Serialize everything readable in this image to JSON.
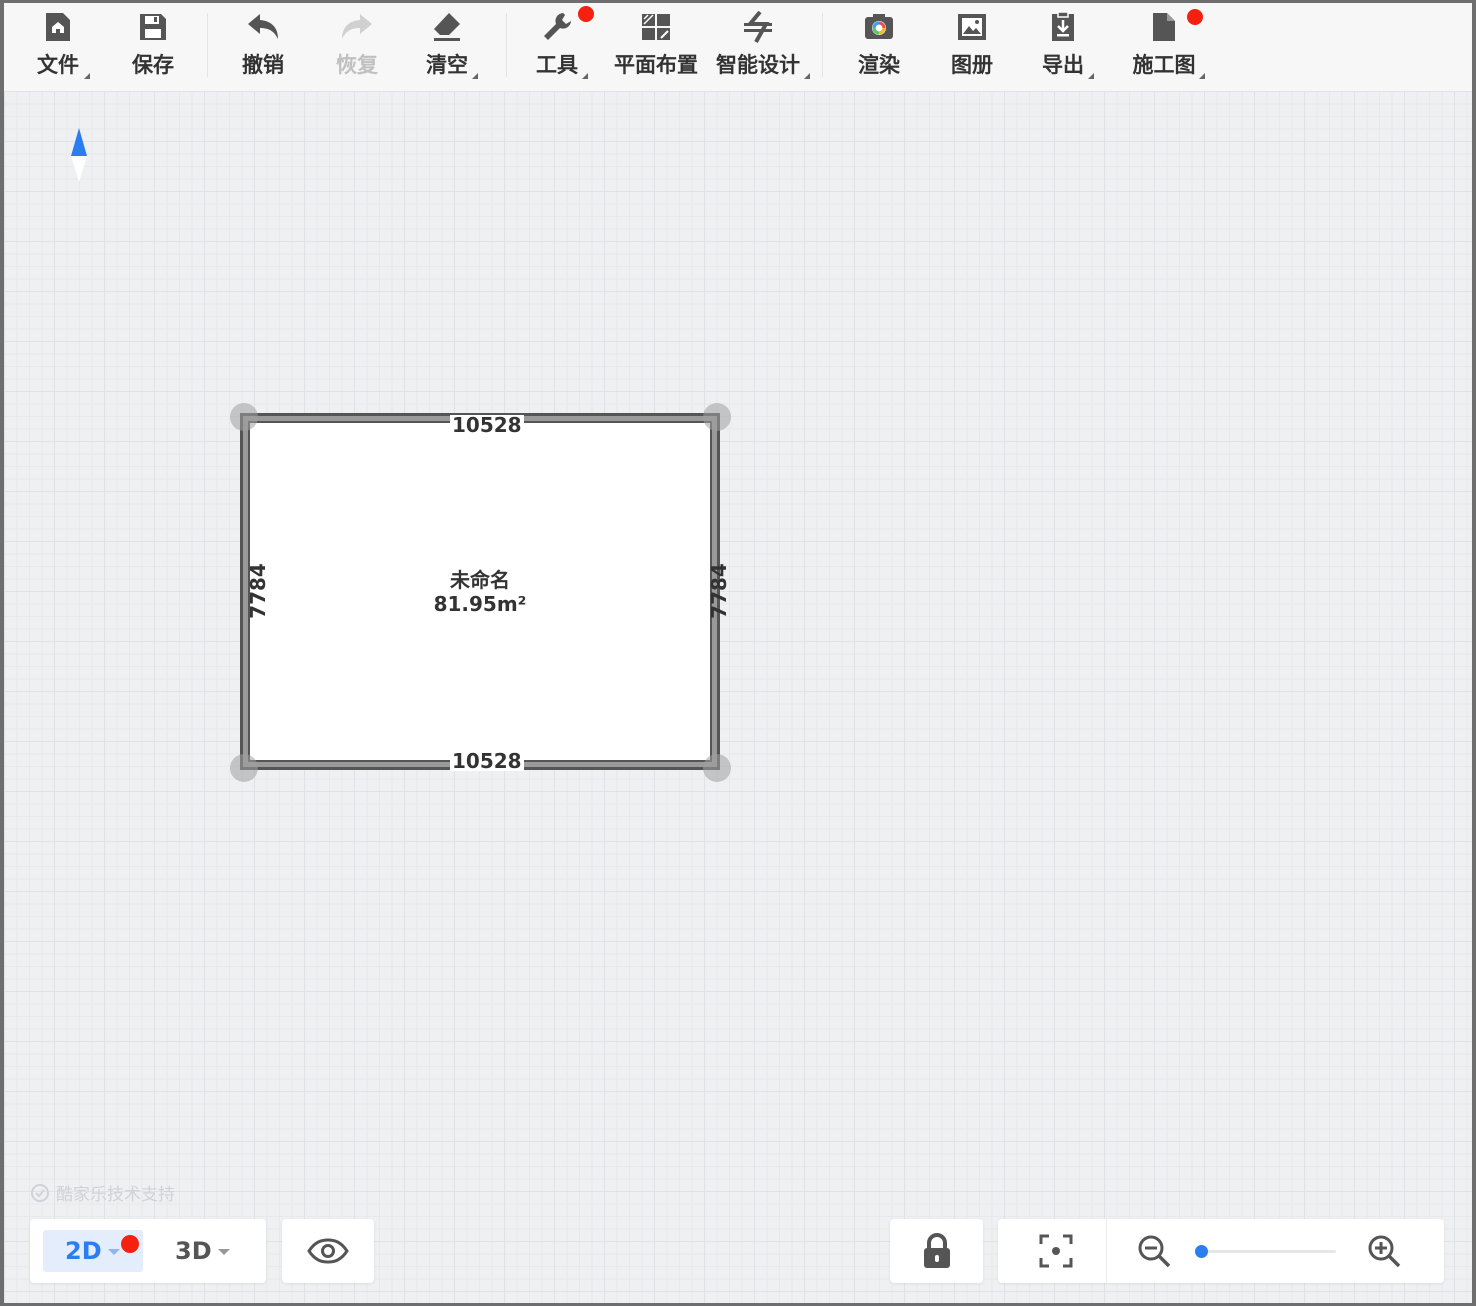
{
  "toolbar": {
    "items": [
      {
        "label": "文件",
        "icon": "file-home-icon",
        "has_menu": true
      },
      {
        "label": "保存",
        "icon": "save-icon"
      },
      {
        "label": "撤销",
        "icon": "undo-icon"
      },
      {
        "label": "恢复",
        "icon": "redo-icon",
        "disabled": true
      },
      {
        "label": "清空",
        "icon": "eraser-icon",
        "has_menu": true
      },
      {
        "label": "工具",
        "icon": "wrench-icon",
        "has_menu": true,
        "notification": true
      },
      {
        "label": "平面布置",
        "icon": "floor-layout-icon"
      },
      {
        "label": "智能设计",
        "icon": "smart-design-icon",
        "has_menu": true
      },
      {
        "label": "渲染",
        "icon": "render-camera-icon"
      },
      {
        "label": "图册",
        "icon": "album-icon"
      },
      {
        "label": "导出",
        "icon": "export-icon",
        "has_menu": true
      },
      {
        "label": "施工图",
        "icon": "construction-drawing-icon",
        "has_menu": true,
        "notification": true
      }
    ]
  },
  "room": {
    "name": "未命名",
    "area": "81.95m²",
    "top_length": "10528",
    "bottom_length": "10528",
    "left_length": "7784",
    "right_length": "7784"
  },
  "support_text": "酷家乐技术支持",
  "view_switch": {
    "mode_2d": "2D",
    "mode_3d": "3D",
    "active": "2D",
    "notification_2d": true
  },
  "zoom": {
    "level": 0.02
  },
  "colors": {
    "accent": "#2b7ef0",
    "notification": "#f5200f",
    "grid_bg": "#eef0f2"
  }
}
